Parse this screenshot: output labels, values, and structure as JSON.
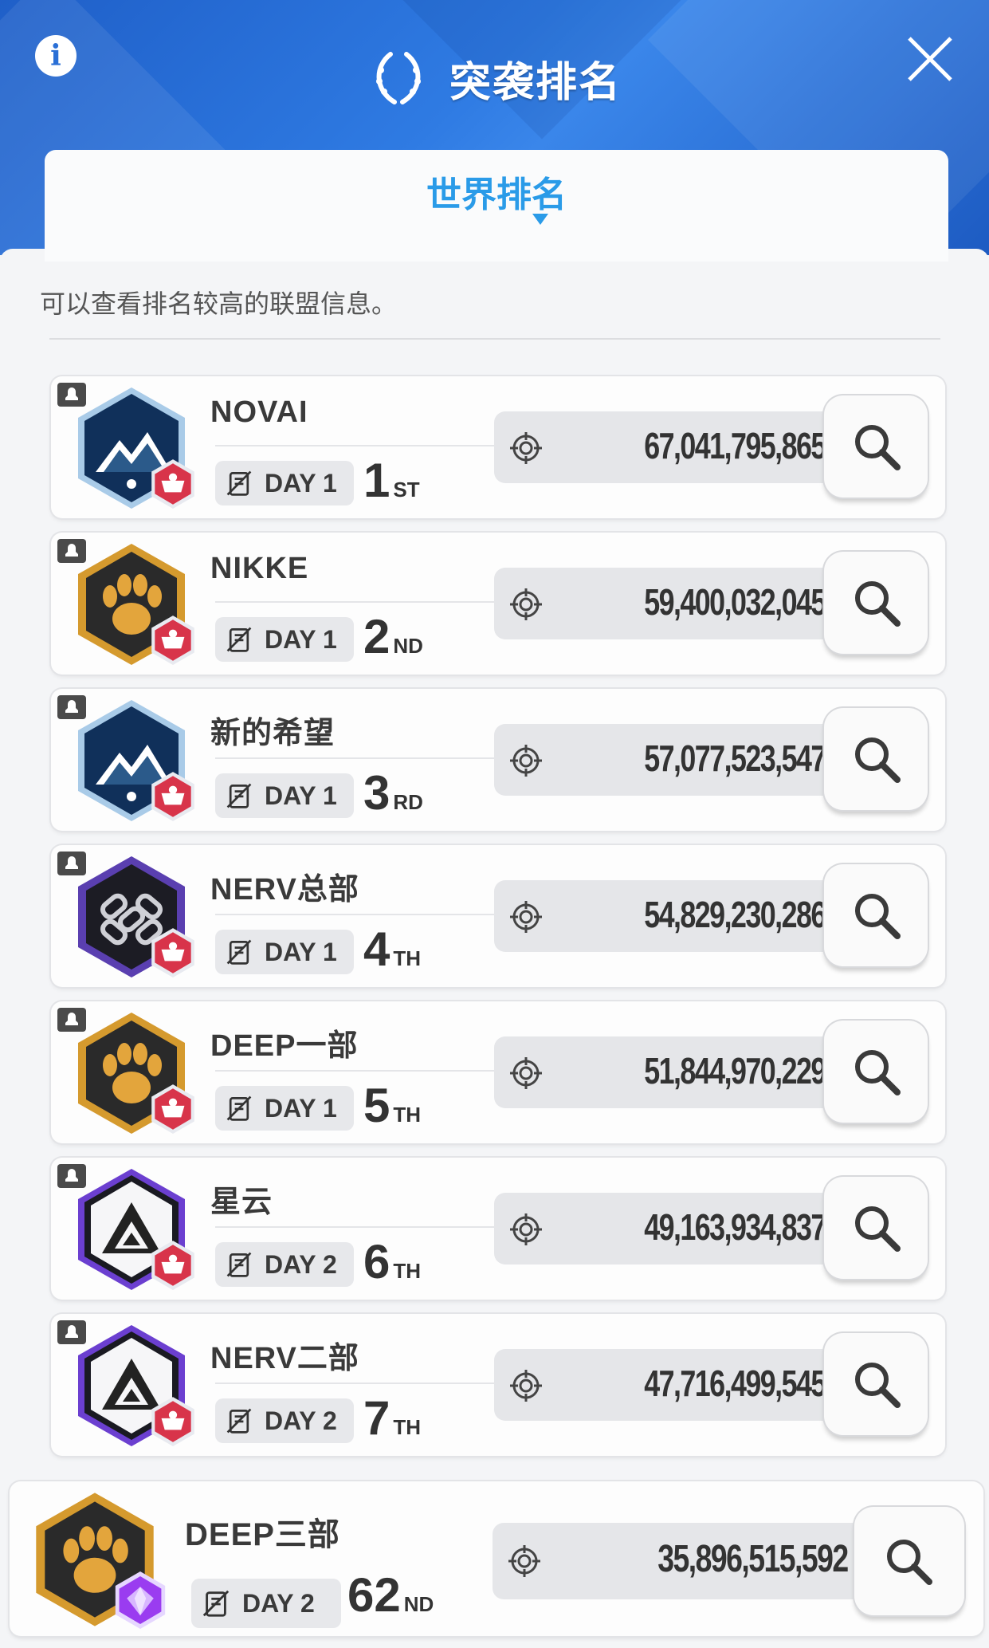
{
  "header": {
    "title": "突袭排名",
    "info_label": "i",
    "close_label": "close"
  },
  "tab": {
    "label": "世界排名"
  },
  "description": "可以查看排名较高的联盟信息。",
  "colors": {
    "accent": "#2a9be8",
    "header_blue": "#2f7be3"
  },
  "rows": [
    {
      "name": "NOVAI",
      "day": "DAY 1",
      "rank_num": "1",
      "rank_suffix": "ST",
      "score": "67,041,795,865",
      "emblem": "mountain-emblem"
    },
    {
      "name": "NIKKE",
      "day": "DAY 1",
      "rank_num": "2",
      "rank_suffix": "ND",
      "score": "59,400,032,045",
      "emblem": "paw-emblem"
    },
    {
      "name": "新的希望",
      "day": "DAY 1",
      "rank_num": "3",
      "rank_suffix": "RD",
      "score": "57,077,523,547",
      "emblem": "mountain-emblem"
    },
    {
      "name": "NERV总部",
      "day": "DAY 1",
      "rank_num": "4",
      "rank_suffix": "TH",
      "score": "54,829,230,286",
      "emblem": "chain-emblem"
    },
    {
      "name": "DEEP一部",
      "day": "DAY 1",
      "rank_num": "5",
      "rank_suffix": "TH",
      "score": "51,844,970,229",
      "emblem": "paw-emblem"
    },
    {
      "name": "星云",
      "day": "DAY 2",
      "rank_num": "6",
      "rank_suffix": "TH",
      "score": "49,163,934,837",
      "emblem": "triangle-emblem"
    },
    {
      "name": "NERV二部",
      "day": "DAY 2",
      "rank_num": "7",
      "rank_suffix": "TH",
      "score": "47,716,499,545",
      "emblem": "triangle-emblem"
    }
  ],
  "my_row": {
    "name": "DEEP三部",
    "day": "DAY 2",
    "rank_num": "62",
    "rank_suffix": "ND",
    "score": "35,896,515,592",
    "emblem": "paw-emblem"
  }
}
